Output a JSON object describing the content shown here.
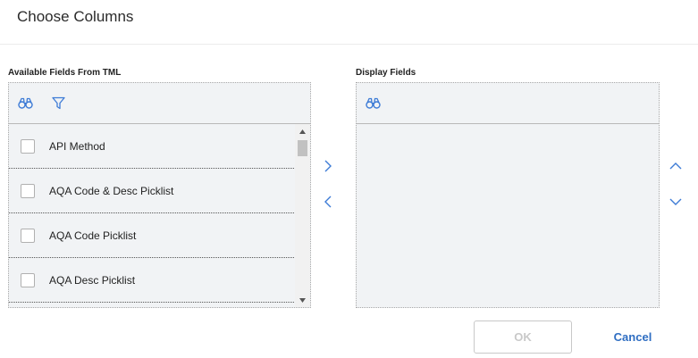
{
  "dialog": {
    "title": "Choose Columns"
  },
  "available": {
    "label": "Available Fields From TML",
    "items": [
      {
        "label": "API Method",
        "checked": false
      },
      {
        "label": "AQA Code & Desc Picklist",
        "checked": false
      },
      {
        "label": "AQA Code Picklist",
        "checked": false
      },
      {
        "label": "AQA Desc Picklist",
        "checked": false
      }
    ]
  },
  "display": {
    "label": "Display Fields",
    "items": []
  },
  "icons": {
    "search": "binoculars-icon",
    "filter": "filter-icon",
    "move_right": "chevron-right-icon",
    "move_left": "chevron-left-icon",
    "move_up": "chevron-up-icon",
    "move_down": "chevron-down-icon"
  },
  "buttons": {
    "ok_label": "OK",
    "cancel_label": "Cancel"
  },
  "colors": {
    "accent": "#2f6ec2",
    "icon": "#3d7bd6",
    "panel_bg": "#f1f3f5",
    "disabled_text": "#c9c9c9"
  }
}
